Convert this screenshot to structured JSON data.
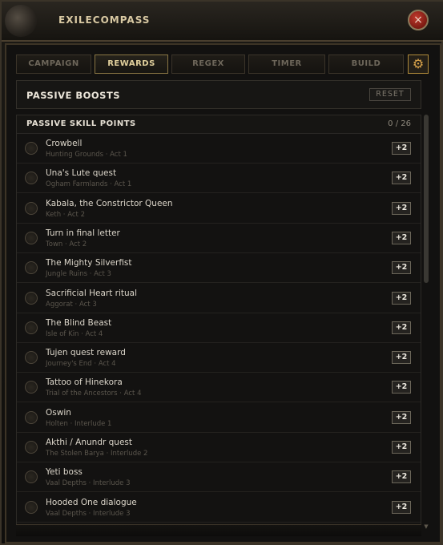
{
  "app": {
    "title": "EXILECOMPASS",
    "close_icon": "×",
    "settings_icon": "⚙"
  },
  "tabs": [
    {
      "label": "CAMPAIGN",
      "active": false
    },
    {
      "label": "REWARDS",
      "active": true
    },
    {
      "label": "REGEX",
      "active": false
    },
    {
      "label": "TIMER",
      "active": false
    },
    {
      "label": "BUILD",
      "active": false
    }
  ],
  "panel": {
    "title": "PASSIVE BOOSTS",
    "reset_label": "RESET"
  },
  "section": {
    "title": "PASSIVE SKILL POINTS",
    "count": "0 / 26"
  },
  "items": [
    {
      "title": "Crowbell",
      "subtitle": "Hunting Grounds · Act 1",
      "points": "+2"
    },
    {
      "title": "Una's Lute quest",
      "subtitle": "Ogham Farmlands · Act 1",
      "points": "+2"
    },
    {
      "title": "Kabala, the Constrictor Queen",
      "subtitle": "Keth · Act 2",
      "points": "+2"
    },
    {
      "title": "Turn in final letter",
      "subtitle": "Town · Act 2",
      "points": "+2"
    },
    {
      "title": "The Mighty Silverfist",
      "subtitle": "Jungle Ruins · Act 3",
      "points": "+2"
    },
    {
      "title": "Sacrificial Heart ritual",
      "subtitle": "Aggorat · Act 3",
      "points": "+2"
    },
    {
      "title": "The Blind Beast",
      "subtitle": "Isle of Kin · Act 4",
      "points": "+2"
    },
    {
      "title": "Tujen quest reward",
      "subtitle": "Journey's End · Act 4",
      "points": "+2"
    },
    {
      "title": "Tattoo of Hinekora",
      "subtitle": "Trial of the Ancestors · Act 4",
      "points": "+2"
    },
    {
      "title": "Oswin",
      "subtitle": "Holten · Interlude 1",
      "points": "+2"
    },
    {
      "title": "Akthi / Anundr quest",
      "subtitle": "The Stolen Barya · Interlude 2",
      "points": "+2"
    },
    {
      "title": "Yeti boss",
      "subtitle": "Vaal Depths · Interlude 3",
      "points": "+2"
    },
    {
      "title": "Hooded One dialogue",
      "subtitle": "Vaal Depths · Interlude 3",
      "points": "+2"
    }
  ]
}
